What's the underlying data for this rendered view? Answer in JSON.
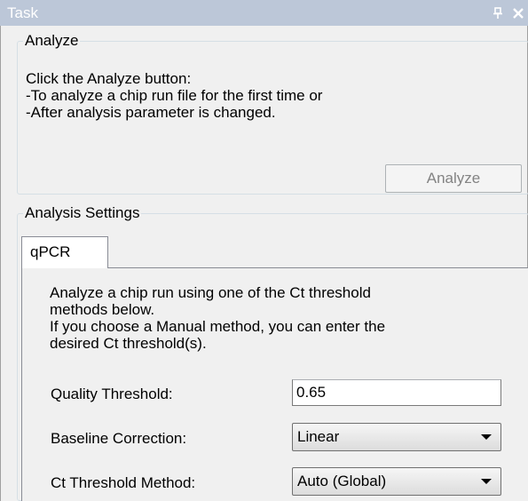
{
  "window": {
    "title": "Task",
    "pin_icon": "pin-icon",
    "close_icon": "close-icon",
    "title_bg": "#bcc7d8"
  },
  "analyze": {
    "legend": "Analyze",
    "lines": [
      "Click the Analyze button:",
      "-To analyze a chip run file for the first time or",
      "-After analysis parameter is changed."
    ],
    "button_label": "Analyze"
  },
  "settings": {
    "legend": "Analysis Settings",
    "tab_label": "qPCR",
    "description": [
      "Analyze a chip run using one of the Ct threshold",
      "methods below.",
      "If you choose a Manual method, you can enter the",
      "desired Ct threshold(s)."
    ],
    "quality_threshold": {
      "label": "Quality Threshold:",
      "value": "0.65"
    },
    "baseline_correction": {
      "label": "Baseline Correction:",
      "value": "Linear"
    },
    "ct_threshold_method": {
      "label": "Ct Threshold Method:",
      "value": "Auto (Global)"
    }
  }
}
